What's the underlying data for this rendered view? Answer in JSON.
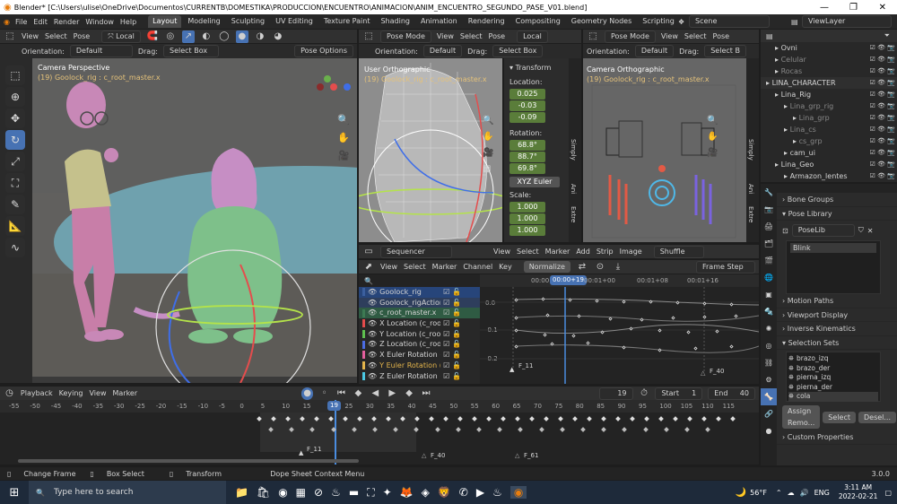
{
  "window": {
    "title": "Blender* [C:\\Users\\ulise\\OneDrive\\Documentos\\CURRENTB\\DOMESTIKA\\PRODUCCION\\ENCUENTRO\\ANIMACION\\ANIM_ENCUENTRO_SEGUNDO_PASE_V01.blend]"
  },
  "menu": [
    "File",
    "Edit",
    "Render",
    "Window",
    "Help"
  ],
  "workspaces": [
    "Layout",
    "Modeling",
    "Sculpting",
    "UV Editing",
    "Texture Paint",
    "Shading",
    "Animation",
    "Rendering",
    "Compositing",
    "Geometry Nodes",
    "Scripting"
  ],
  "scene": "Scene",
  "view_layer": "ViewLayer",
  "viewport_left": {
    "menu": [
      "View",
      "Select",
      "Pose"
    ],
    "transform": "Local",
    "orientation_label": "Orientation:",
    "orientation": "Default",
    "drag_label": "Drag:",
    "drag": "Select Box",
    "options": "Pose Options",
    "view_name": "Camera Perspective",
    "object_info": "(19) Goolock_rig : c_root_master.x"
  },
  "viewport_mid": {
    "mode": "Pose Mode",
    "menu": [
      "View",
      "Select",
      "Pose"
    ],
    "transform": "Local",
    "orientation": "Default",
    "drag": "Select Box",
    "view_name": "User Orthographic",
    "object_info": "(19) Goolock_rig : c_root_master.x"
  },
  "viewport_right": {
    "mode": "Pose Mode",
    "menu": [
      "View",
      "Select",
      "Pose"
    ],
    "orientation": "Default",
    "drag": "Select B",
    "view_name": "Camera Orthographic",
    "object_info": "(19) Goolock_rig : c_root_master.x"
  },
  "npanel": {
    "title": "Transform",
    "location_label": "Location:",
    "location": [
      "0.025",
      "-0.03",
      "-0.09"
    ],
    "rotation_label": "Rotation:",
    "rotation": [
      "68.8°",
      "88.7°",
      "69.8°"
    ],
    "rotation_mode": "XYZ Euler",
    "scale_label": "Scale:",
    "scale": [
      "1.000",
      "1.000",
      "1.000"
    ],
    "tabs": [
      "Simply",
      "Ani",
      "Extre"
    ]
  },
  "sequencer": {
    "title": "Sequencer",
    "menu": [
      "View",
      "Select",
      "Marker",
      "Add",
      "Strip",
      "Image"
    ],
    "shuffle": "Shuffle"
  },
  "graph": {
    "menu": [
      "View",
      "Select",
      "Marker",
      "Channel",
      "Key"
    ],
    "normalize": "Normalize",
    "frame_step": "Frame Step",
    "timecodes": [
      "00:00",
      "00:00+19",
      "00:01+00",
      "00:01+08",
      "00:01+16"
    ],
    "values": [
      "0.0",
      "-0.1",
      "-0.2"
    ],
    "markers": [
      "F_11",
      "F_40"
    ],
    "channels": [
      {
        "name": "Goolock_rig",
        "color": "#3b5f9e"
      },
      {
        "name": "Goolock_rigAction",
        "color": ""
      },
      {
        "name": "c_root_master.x",
        "color": "#3d7a53"
      },
      {
        "name": "X Location (c_root",
        "color": "#e34b4b"
      },
      {
        "name": "Y Location (c_root",
        "color": "#5fc04f"
      },
      {
        "name": "Z Location (c_root",
        "color": "#4b6ce3"
      },
      {
        "name": "X Euler Rotation (c",
        "color": "#e35f9d"
      },
      {
        "name": "Y Euler Rotation (c",
        "color": "#e3b44b"
      },
      {
        "name": "Z Euler Rotation (c",
        "color": "#4bc8e3"
      }
    ]
  },
  "outliner": {
    "items": [
      {
        "name": "Ovni",
        "indent": 1
      },
      {
        "name": "Celular",
        "indent": 1
      },
      {
        "name": "Rocas",
        "indent": 1
      },
      {
        "name": "LINA_CHARACTER",
        "indent": 0
      },
      {
        "name": "Lina_Rig",
        "indent": 1
      },
      {
        "name": "Lina_grp_rig",
        "indent": 2
      },
      {
        "name": "Lina_grp",
        "indent": 3
      },
      {
        "name": "Lina_cs",
        "indent": 2
      },
      {
        "name": "cs_grp",
        "indent": 3
      },
      {
        "name": "cam_ui",
        "indent": 2
      },
      {
        "name": "Lina_Geo",
        "indent": 1
      },
      {
        "name": "Armazon_lentes",
        "indent": 2
      }
    ]
  },
  "properties": {
    "sections_top": [
      "Bone Groups",
      "Pose Library"
    ],
    "poselib": "PoseLib",
    "poses": [
      "Blink"
    ],
    "sections_mid": [
      "Motion Paths",
      "Viewport Display",
      "Inverse Kinematics",
      "Selection Sets"
    ],
    "selection_sets": [
      "brazo_izq",
      "brazo_der",
      "pierna_izq",
      "pierna_der",
      "cola"
    ],
    "assign_btn": "Assign Remo...",
    "select_btn": "Select",
    "deselect_btn": "Desel...",
    "custom": "Custom Properties"
  },
  "timeline": {
    "menu": [
      "Playback",
      "Keying",
      "View",
      "Marker"
    ],
    "current_frame": "19",
    "start_label": "Start",
    "start": "1",
    "end_label": "End",
    "end": "40",
    "ticks": [
      "-55",
      "-50",
      "-45",
      "-40",
      "-35",
      "-30",
      "-25",
      "-20",
      "-15",
      "-10",
      "-5",
      "0",
      "5",
      "10",
      "15",
      "19",
      "25",
      "30",
      "35",
      "40",
      "45",
      "50",
      "55",
      "60",
      "65",
      "70",
      "75",
      "80",
      "85",
      "90",
      "95",
      "100",
      "105",
      "110",
      "115"
    ],
    "markers": [
      "F_11",
      "F_40",
      "F_61"
    ]
  },
  "status": {
    "items": [
      "Change Frame",
      "Box Select",
      "Transform",
      "Dope Sheet Context Menu"
    ],
    "version": "3.0.0"
  },
  "taskbar": {
    "search": "Type here to search",
    "temp": "56°F",
    "lang": "ENG",
    "time": "3:11 AM",
    "date": "2022-02-21"
  },
  "colors": {
    "accent": "#4772b3",
    "green_field": "#5a7d3a",
    "playhead": "#4a8de0",
    "bg": "#1d1d1d",
    "header": "#303030"
  }
}
